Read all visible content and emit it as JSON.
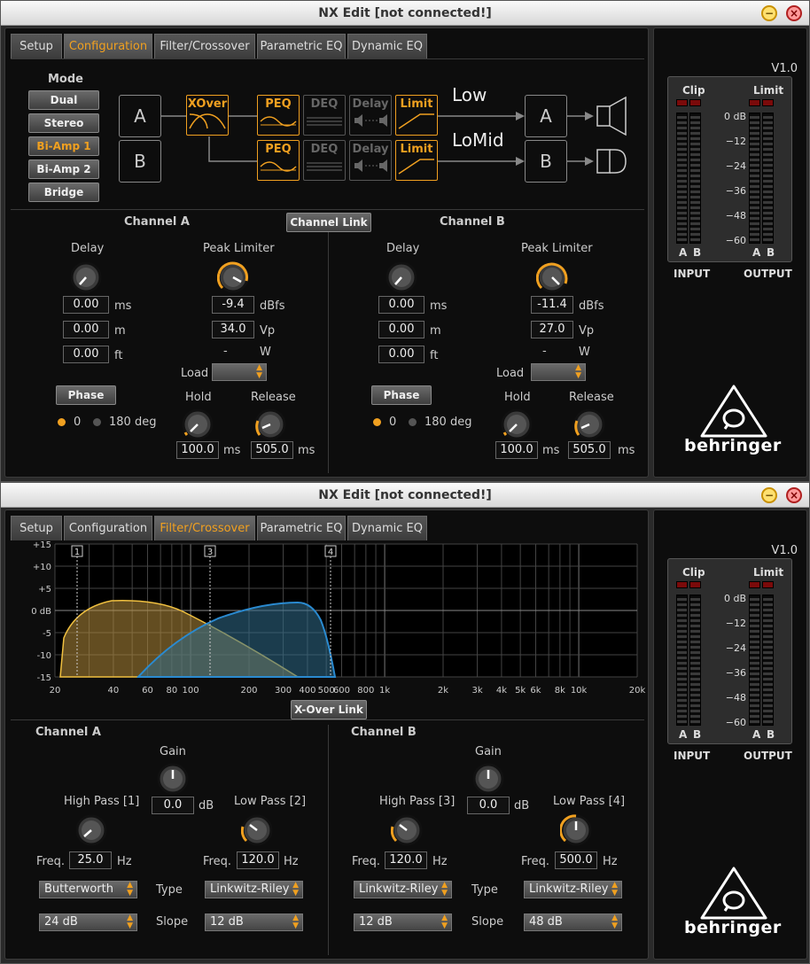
{
  "app": {
    "title": "NX Edit [not connected!]",
    "version": "V1.0",
    "min_icon": "minimize-icon",
    "close_icon": "close-icon"
  },
  "tabs": [
    "Setup",
    "Configuration",
    "Filter/Crossover",
    "Parametric EQ",
    "Dynamic EQ"
  ],
  "meters": {
    "clip": "Clip",
    "limit": "Limit",
    "input": "INPUT",
    "output": "OUTPUT",
    "a": "A",
    "b": "B",
    "scale": [
      "0 dB",
      "−12",
      "−24",
      "−36",
      "−48",
      "−60"
    ]
  },
  "brand": "behringer",
  "config": {
    "mode_label": "Mode",
    "modes": [
      "Dual",
      "Stereo",
      "Bi-Amp 1",
      "Bi-Amp 2",
      "Bridge"
    ],
    "active_mode": "Bi-Amp 1",
    "in_a": "A",
    "in_b": "B",
    "out_a": "A",
    "out_b": "B",
    "xover": "XOver",
    "peq": "PEQ",
    "deq": "DEQ",
    "delay": "Delay",
    "limit": "Limit",
    "band_low": "Low",
    "band_lomid": "LoMid",
    "channel_link": "Channel Link",
    "channels": [
      {
        "title": "Channel A",
        "delay_label": "Delay",
        "delay_ms": "0.00",
        "delay_m": "0.00",
        "delay_ft": "0.00",
        "peak_label": "Peak Limiter",
        "peak_dbfs": "-9.4",
        "peak_vp": "34.0",
        "watt": "-",
        "load_label": "Load",
        "hold_label": "Hold",
        "release_label": "Release",
        "hold": "100.0",
        "release": "505.0",
        "phase_label": "Phase",
        "phase_0": "0",
        "phase_180": "180 deg"
      },
      {
        "title": "Channel B",
        "delay_label": "Delay",
        "delay_ms": "0.00",
        "delay_m": "0.00",
        "delay_ft": "0.00",
        "peak_label": "Peak Limiter",
        "peak_dbfs": "-11.4",
        "peak_vp": "27.0",
        "watt": "-",
        "load_label": "Load",
        "hold_label": "Hold",
        "release_label": "Release",
        "hold": "100.0",
        "release": "505.0",
        "phase_label": "Phase",
        "phase_0": "0",
        "phase_180": "180 deg"
      }
    ],
    "units": {
      "ms": "ms",
      "m": "m",
      "ft": "ft",
      "dbfs": "dBfs",
      "vp": "Vp",
      "w": "W",
      "db": "dB",
      "hz": "Hz"
    }
  },
  "filter": {
    "xover_link": "X-Over Link",
    "markers": [
      "1",
      "3",
      "4"
    ],
    "y_ticks": [
      "+15",
      "+10",
      "+5",
      "0 dB",
      "-5",
      "-10",
      "-15"
    ],
    "x_ticks": [
      "20",
      "40",
      "60",
      "80",
      "100",
      "200",
      "300",
      "400",
      "500",
      "600",
      "800",
      "1k",
      "2k",
      "3k",
      "4k",
      "5k",
      "6k",
      "8k",
      "10k",
      "20k"
    ],
    "channels": [
      {
        "title": "Channel A",
        "gain_label": "Gain",
        "gain": "0.0",
        "hp_label": "High Pass [1]",
        "lp_label": "Low Pass [2]",
        "freq_label": "Freq.",
        "hp_freq": "25.0",
        "lp_freq": "120.0",
        "type_label": "Type",
        "slope_label": "Slope",
        "hp_type": "Butterworth",
        "lp_type": "Linkwitz-Riley",
        "hp_slope": "24 dB",
        "lp_slope": "12 dB"
      },
      {
        "title": "Channel B",
        "gain_label": "Gain",
        "gain": "0.0",
        "hp_label": "High Pass [3]",
        "lp_label": "Low Pass [4]",
        "freq_label": "Freq.",
        "hp_freq": "120.0",
        "lp_freq": "500.0",
        "type_label": "Type",
        "slope_label": "Slope",
        "hp_type": "Linkwitz-Riley",
        "lp_type": "Linkwitz-Riley",
        "hp_slope": "12 dB",
        "lp_slope": "48 dB"
      }
    ]
  },
  "colors": {
    "accent": "#f0a020",
    "blue": "#2a8ad0"
  }
}
